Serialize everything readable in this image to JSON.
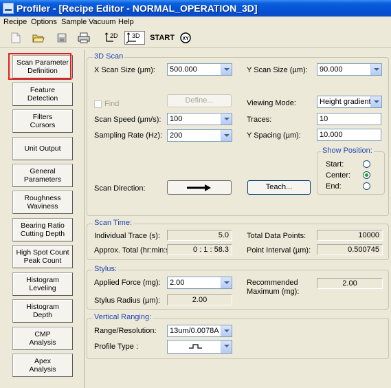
{
  "window": {
    "title": "Profiler - [Recipe Editor - NORMAL_OPERATION_3D]"
  },
  "menu": [
    "Recipe",
    "Options",
    "Sample",
    "Vacuum",
    "Help"
  ],
  "toolbar": {
    "mode2d": "2D",
    "mode3d": "3D",
    "start": "START"
  },
  "nav": [
    {
      "line1": "Scan Parameter",
      "line2": "Definition"
    },
    {
      "line1": "Feature",
      "line2": "Detection"
    },
    {
      "line1": "Filters",
      "line2": "Cursors"
    },
    {
      "line1": "Unit Output",
      "line2": ""
    },
    {
      "line1": "General",
      "line2": "Parameters"
    },
    {
      "line1": "Roughness",
      "line2": "Waviness"
    },
    {
      "line1": "Bearing Ratio",
      "line2": "Cutting Depth"
    },
    {
      "line1": "High Spot Count",
      "line2": "Peak Count"
    },
    {
      "line1": "Histogram",
      "line2": "Leveling"
    },
    {
      "line1": "Histogram",
      "line2": "Depth"
    },
    {
      "line1": "CMP",
      "line2": "Analysis"
    },
    {
      "line1": "Apex",
      "line2": "Analysis"
    }
  ],
  "scan3d": {
    "legend": "3D Scan",
    "x_size_label": "X Scan Size (µm):",
    "x_size": "500.000",
    "y_size_label": "Y Scan Size (µm):",
    "y_size": "90.000",
    "find_label": "Find",
    "define_label": "Define...",
    "viewing_mode_label": "Viewing Mode:",
    "viewing_mode": "Height gradient",
    "speed_label": "Scan Speed (µm/s):",
    "speed": "100",
    "traces_label": "Traces:",
    "traces": "10",
    "rate_label": "Sampling Rate (Hz):",
    "rate": "200",
    "y_spacing_label": "Y Spacing (µm):",
    "y_spacing": "10.000",
    "show_position_legend": "Show Position:",
    "pos_start": "Start:",
    "pos_center": "Center:",
    "pos_end": "End:",
    "direction_label": "Scan Direction:",
    "teach_label": "Teach..."
  },
  "scan_time": {
    "legend": "Scan Time:",
    "individual_label": "Individual Trace (s):",
    "individual": "5.0",
    "approx_label": "Approx. Total (hr:min:s):",
    "approx": "0 : 1 : 58.3",
    "total_points_label": "Total Data Points:",
    "total_points": "10000",
    "interval_label": "Point Interval (µm):",
    "interval": "0.500745"
  },
  "stylus": {
    "legend": "Stylus:",
    "force_label": "Applied Force (mg):",
    "force": "2.00",
    "radius_label": "Stylus Radius (µm):",
    "radius": "2.00",
    "rec_line1": "Recommended",
    "rec_line2": "Maximum (mg):",
    "rec": "2.00"
  },
  "ranging": {
    "legend": "Vertical Ranging:",
    "range_label": "Range/Resolution:",
    "range": "13um/0.0078A",
    "profile_label": "Profile Type :"
  }
}
